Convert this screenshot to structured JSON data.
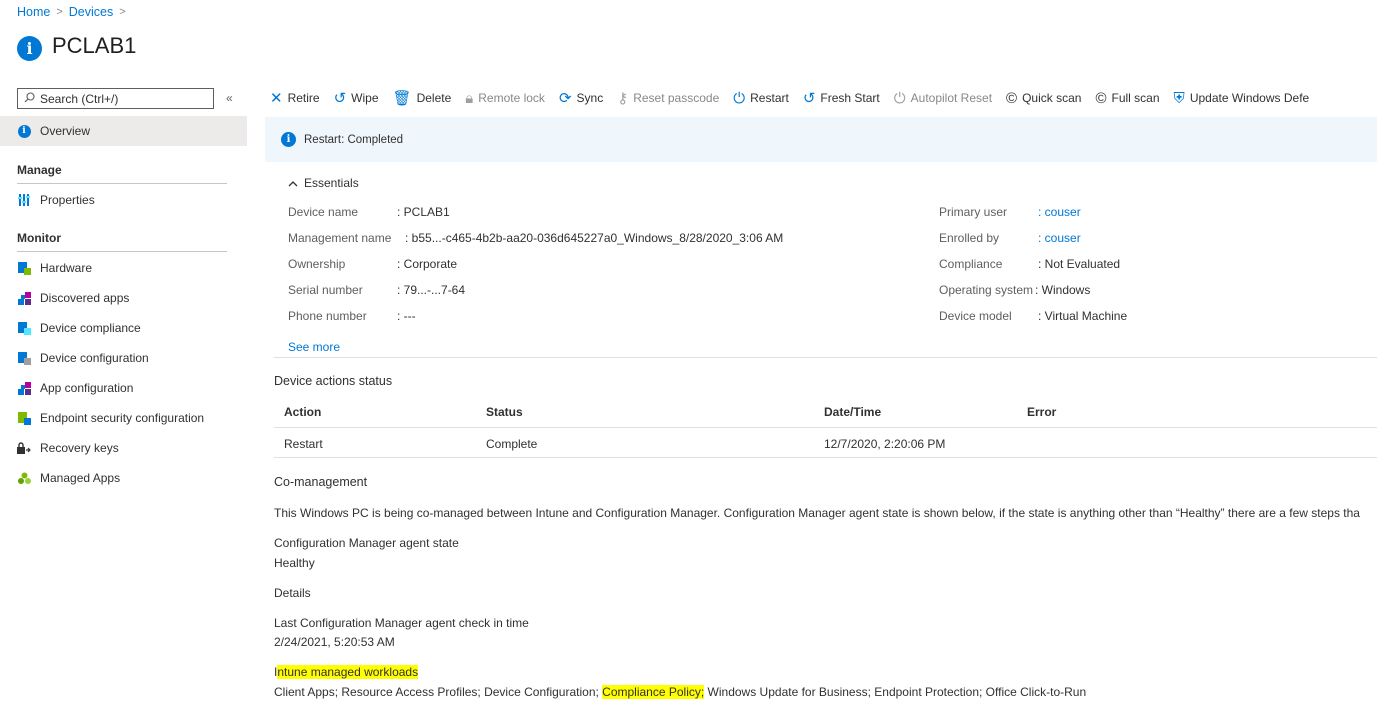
{
  "breadcrumb": {
    "home": "Home",
    "devices": "Devices",
    "sep": ">"
  },
  "page": {
    "title": "PCLAB1",
    "icon": "info-icon"
  },
  "sidebar": {
    "search_placeholder": "Search (Ctrl+/)",
    "collapse": "«",
    "overview": "Overview",
    "manage_header": "Manage",
    "properties": "Properties",
    "monitor_header": "Monitor",
    "items": [
      {
        "label": "Hardware",
        "icon": "hardware-icon"
      },
      {
        "label": "Discovered apps",
        "icon": "apps-icon"
      },
      {
        "label": "Device compliance",
        "icon": "compliance-icon"
      },
      {
        "label": "Device configuration",
        "icon": "configuration-icon"
      },
      {
        "label": "App configuration",
        "icon": "app-config-icon"
      },
      {
        "label": "Endpoint security configuration",
        "icon": "endpoint-security-icon"
      },
      {
        "label": "Recovery keys",
        "icon": "key-icon"
      },
      {
        "label": "Managed Apps",
        "icon": "managed-apps-icon"
      }
    ]
  },
  "toolbar": {
    "retire": "Retire",
    "wipe": "Wipe",
    "delete": "Delete",
    "remote_lock": "Remote lock",
    "sync": "Sync",
    "reset_passcode": "Reset passcode",
    "restart": "Restart",
    "fresh_start": "Fresh Start",
    "autopilot_reset": "Autopilot Reset",
    "quick_scan": "Quick scan",
    "full_scan": "Full scan",
    "update_defender": "Update Windows Defe"
  },
  "banner": {
    "text": "Restart: Completed"
  },
  "essentials": {
    "header": "Essentials",
    "left": [
      {
        "key": "Device name",
        "value": ": PCLAB1"
      },
      {
        "key": "Management name",
        "value": ": b55...-c465-4b2b-aa20-036d645227a0_Windows_8/28/2020_3:06 AM"
      },
      {
        "key": "Ownership",
        "value": ": Corporate"
      },
      {
        "key": "Serial number",
        "value": ": 79...-...7-64"
      },
      {
        "key": "Phone number",
        "value": ": ---"
      }
    ],
    "right": [
      {
        "key": "Primary user",
        "value": ": couser"
      },
      {
        "key": "Enrolled by",
        "value": ": couser"
      },
      {
        "key": "Compliance",
        "value": ": Not Evaluated"
      },
      {
        "key": "Operating system",
        "value": ": Windows"
      },
      {
        "key": "Device model",
        "value": ": Virtual Machine"
      }
    ],
    "see_more": "See more"
  },
  "device_actions": {
    "title": "Device actions status",
    "columns": [
      "Action",
      "Status",
      "Date/Time",
      "Error"
    ],
    "rows": [
      {
        "action": "Restart",
        "status": "Complete",
        "datetime": "12/7/2020, 2:20:06 PM",
        "error": ""
      }
    ]
  },
  "comanagement": {
    "title": "Co-management",
    "description": "This Windows PC is being co-managed between Intune and Configuration Manager. Configuration Manager agent state is shown below, if the state is anything other than “Healthy” there are a few steps tha",
    "agent_state_label": "Configuration Manager agent state",
    "agent_state_value": "Healthy",
    "details": "Details",
    "checkin_label": "Last Configuration Manager agent check in time",
    "checkin_value": "2/24/2021, 5:20:53 AM",
    "workloads_label_first": "I",
    "workloads_label_rest": "ntune managed workloads",
    "workloads_part1": "Client Apps; Resource Access Profiles; Device Configuration; ",
    "workloads_highlight": "Compliance Policy;",
    "workloads_part2": " Windows Update for Business; Endpoint Protection; Office Click-to-Run"
  },
  "colors": {
    "accent": "#0078d4",
    "highlight": "#ffff00",
    "banner_bg": "#eff6fc"
  }
}
